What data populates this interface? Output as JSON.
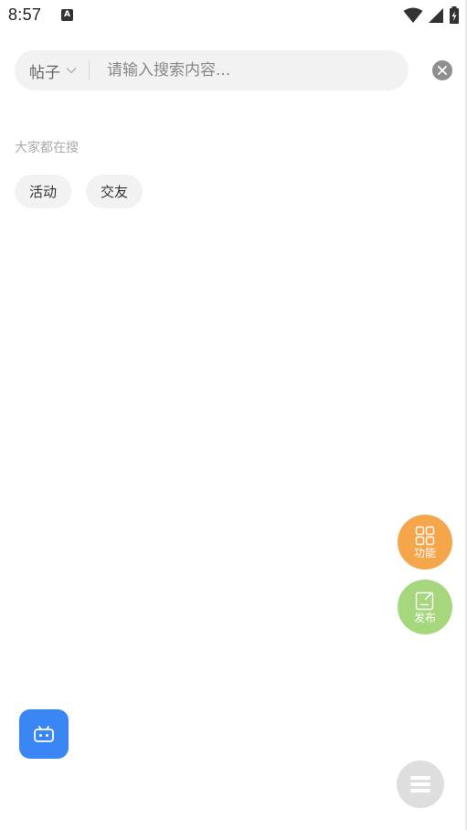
{
  "status_bar": {
    "time": "8:57",
    "a_icon_letter": "A",
    "icons": [
      "a-notification-icon",
      "wifi-icon",
      "signal-icon",
      "battery-charging-icon"
    ]
  },
  "search": {
    "type_label": "帖子",
    "placeholder": "请输入搜索内容...",
    "value": ""
  },
  "hot": {
    "title": "大家都在搜",
    "tags": [
      {
        "label": "活动"
      },
      {
        "label": "交友"
      }
    ]
  },
  "fabs": {
    "function_label": "功能",
    "publish_label": "发布"
  },
  "colors": {
    "function_fab": "#f5a64a",
    "publish_fab": "#a7d77d",
    "robot_button": "#3a86f5",
    "menu_button": "#dedede",
    "search_bg": "#f2f2f2"
  }
}
